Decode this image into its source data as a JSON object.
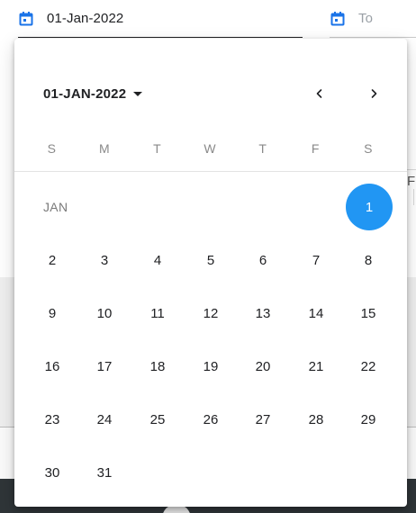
{
  "inputs": {
    "from": {
      "value": "01-Jan-2022",
      "icon": "calendar-icon"
    },
    "to": {
      "placeholder": "To",
      "icon": "calendar-icon"
    }
  },
  "calendar": {
    "period_label": "01-JAN-2022",
    "weekdays": [
      "S",
      "M",
      "T",
      "W",
      "T",
      "F",
      "S"
    ],
    "month_label": "JAN",
    "selected_day": "1",
    "days": {
      "d1": "1",
      "d2": "2",
      "d3": "3",
      "d4": "4",
      "d5": "5",
      "d6": "6",
      "d7": "7",
      "d8": "8",
      "d9": "9",
      "d10": "10",
      "d11": "11",
      "d12": "12",
      "d13": "13",
      "d14": "14",
      "d15": "15",
      "d16": "16",
      "d17": "17",
      "d18": "18",
      "d19": "19",
      "d20": "20",
      "d21": "21",
      "d22": "22",
      "d23": "23",
      "d24": "24",
      "d25": "25",
      "d26": "26",
      "d27": "27",
      "d28": "28",
      "d29": "29",
      "d30": "30",
      "d31": "31"
    }
  },
  "background": {
    "partial_letter": "F"
  },
  "colors": {
    "accent": "#2196f3",
    "icon": "#1a73e8",
    "text": "#202124",
    "muted": "#8a8a8a"
  }
}
